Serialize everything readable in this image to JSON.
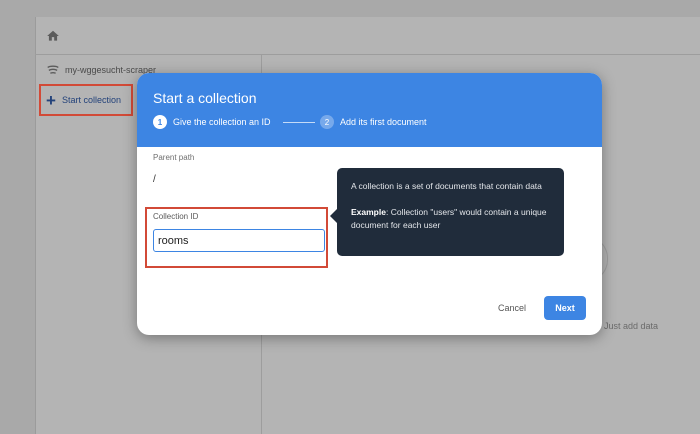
{
  "background": {
    "database_name": "my-wggesucht-scraper",
    "start_collection_label": "Start collection",
    "hint_text": "Just add data",
    "home_icon": "home-icon",
    "database_icon": "database-icon"
  },
  "dialog": {
    "title": "Start a collection",
    "steps": [
      {
        "number": "1",
        "label": "Give the collection an ID"
      },
      {
        "number": "2",
        "label": "Add its first document"
      }
    ],
    "parent_path": {
      "label": "Parent path",
      "value": "/"
    },
    "collection_id": {
      "label": "Collection ID",
      "value": "rooms"
    },
    "tooltip": {
      "line1": "A collection is a set of documents that contain data",
      "example_label": "Example",
      "example_text": ": Collection \"users\" would contain a unique document for each user"
    },
    "cancel_label": "Cancel",
    "next_label": "Next"
  },
  "colors": {
    "header_blue": "#3d85e3",
    "highlight_red": "#d24a37",
    "tooltip_bg": "#202c3b"
  }
}
